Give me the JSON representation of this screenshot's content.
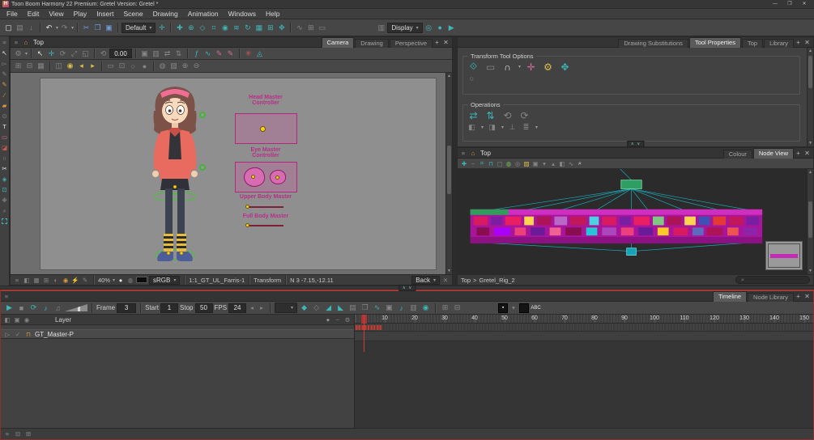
{
  "titlebar": {
    "title": "Toon Boom Harmony 22 Premium: Gretel Version: Gretel *"
  },
  "menubar": {
    "items": [
      "File",
      "Edit",
      "View",
      "Play",
      "Insert",
      "Scene",
      "Drawing",
      "Animation",
      "Windows",
      "Help"
    ]
  },
  "main_toolbar": {
    "workspace_value": "Default",
    "display_value": "Display"
  },
  "camera_panel": {
    "title": "Top",
    "tabs": [
      "Camera",
      "Drawing",
      "Perspective"
    ],
    "active_tab": "Camera",
    "rotation_value": "0.00",
    "controllers": {
      "head_label": "Head Master Controller",
      "eye_label": "Eye Master Controller",
      "upper_label": "Upper Body Master",
      "full_label": "Full Body Master"
    },
    "status": {
      "zoom": "40%",
      "colorspace": "sRGB",
      "selection": "1:1_GT_UL_Farris-1",
      "tool": "Transform",
      "frame": "N 3",
      "coords": "-7.15,-12.11",
      "camera": "Back"
    }
  },
  "tool_properties": {
    "tabs": [
      "Drawing Substitutions",
      "Tool Properties",
      "Top",
      "Library"
    ],
    "active_tab": "Tool Properties",
    "transform_section_label": "Transform Tool Options",
    "operations_section_label": "Operations"
  },
  "node_view": {
    "title": "Top",
    "tabs": [
      "Colour",
      "Node View"
    ],
    "active_tab": "Node View",
    "breadcrumb": {
      "root": "Top",
      "separator": ">",
      "current": "Gretel_Rig_2"
    }
  },
  "timeline": {
    "tabs": [
      "Timeline",
      "Node Library"
    ],
    "active_tab": "Timeline",
    "frame_label": "Frame",
    "frame_value": "3",
    "start_label": "Start",
    "start_value": "1",
    "stop_label": "Stop",
    "stop_value": "50",
    "fps_label": "FPS",
    "fps_value": "24",
    "abc_icon_label": "ABC",
    "layers_header": "Layer",
    "layers": [
      {
        "name": "GT_Master-P"
      }
    ],
    "current_frame": 3,
    "ruler_numbers": [
      "10",
      "20",
      "30",
      "40",
      "50",
      "60",
      "70",
      "80",
      "90",
      "100",
      "110",
      "120",
      "130",
      "140",
      "150"
    ]
  }
}
